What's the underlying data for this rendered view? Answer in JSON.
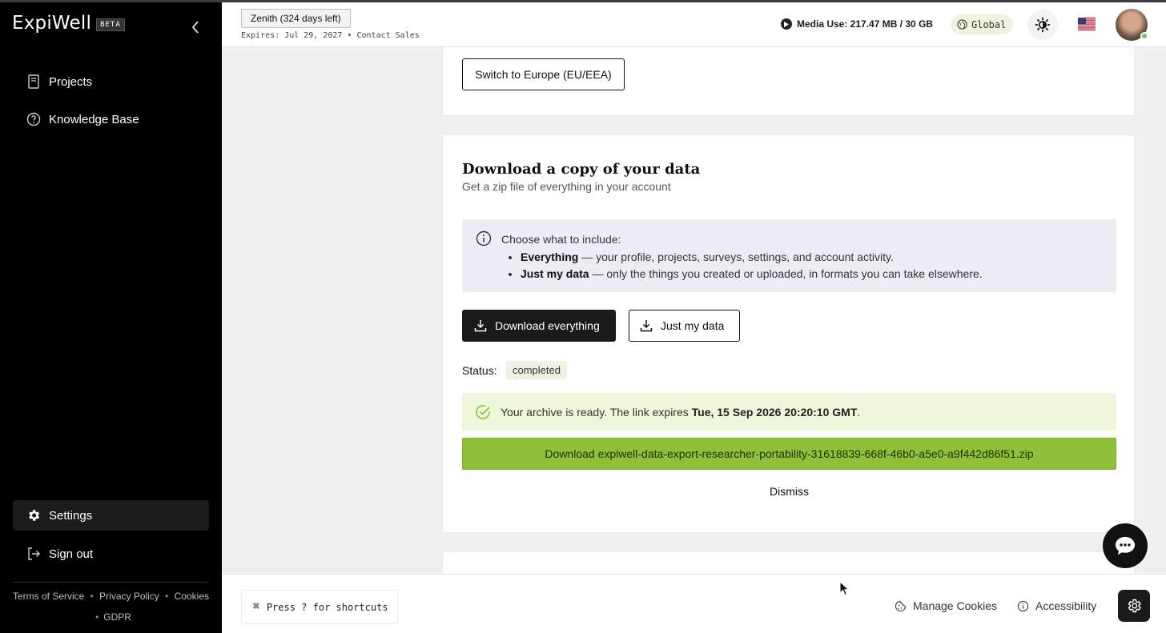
{
  "app": {
    "logo": "ExpiWell",
    "beta": "BETA"
  },
  "sidebar": {
    "items": [
      {
        "label": "Projects"
      },
      {
        "label": "Knowledge Base"
      }
    ],
    "settings": "Settings",
    "signout": "Sign out",
    "footer_links": [
      "Terms of Service",
      "Privacy Policy",
      "Cookies",
      "GDPR"
    ]
  },
  "header": {
    "plan": "Zenith (324 days left)",
    "expires": "Expires: Jul 29, 2027 • Contact Sales",
    "media_use": "Media Use: 217.47 MB / 30 GB",
    "region": "Global"
  },
  "region_card": {
    "switch_button": "Switch to Europe (EU/EEA)"
  },
  "download_card": {
    "title": "Download a copy of your data",
    "subtitle": "Get a zip file of everything in your account",
    "info_lead": "Choose what to include:",
    "info_items": [
      {
        "bold": "Everything",
        "text": " — your profile, projects, surveys, settings, and account activity."
      },
      {
        "bold": "Just my data",
        "text": " — only the things you created or uploaded, in formats you can take elsewhere."
      }
    ],
    "btn_everything": "Download everything",
    "btn_just_data": "Just my data",
    "status_label": "Status:",
    "status_value": "completed",
    "ready_prefix": "Your archive is ready. The link expires ",
    "ready_date": "Tue, 15 Sep 2026 20:20:10 GMT",
    "ready_suffix": ".",
    "download_link": "Download expiwell-data-export-researcher-portability-31618839-668f-46b0-a5e0-a9f442d86f51.zip",
    "dismiss": "Dismiss"
  },
  "footer": {
    "shortcut": "Press ? for shortcuts",
    "manage_cookies": "Manage Cookies",
    "accessibility": "Accessibility"
  },
  "colors": {
    "sidebar_bg": "#000000",
    "primary_dark": "#1a1a1a",
    "success_green": "#8fc03a",
    "success_bg": "#eef6dc",
    "info_bg": "#eaeef4"
  }
}
